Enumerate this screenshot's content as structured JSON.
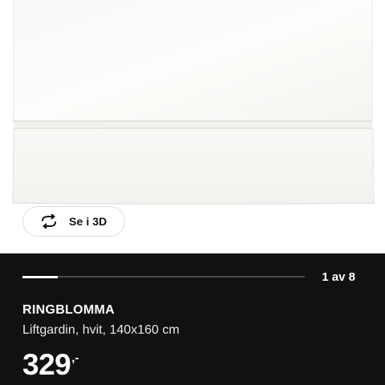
{
  "gallery": {
    "view_3d_label": "Se i 3D",
    "current_slide": 1,
    "total_slides": 8,
    "counter_text": "1 av 8",
    "progress_fraction": 0.125,
    "icons": {
      "view_3d": "rotate-arrows-icon"
    }
  },
  "product": {
    "name": "RINGBLOMMA",
    "description": "Liftgardin, hvit, 140x160 cm",
    "price_amount": "329",
    "price_suffix": ",-"
  },
  "colors": {
    "panel_background": "#111111",
    "panel_text": "#ffffff",
    "progress_track": "#4a4a4a",
    "progress_fill": "#ffffff"
  }
}
